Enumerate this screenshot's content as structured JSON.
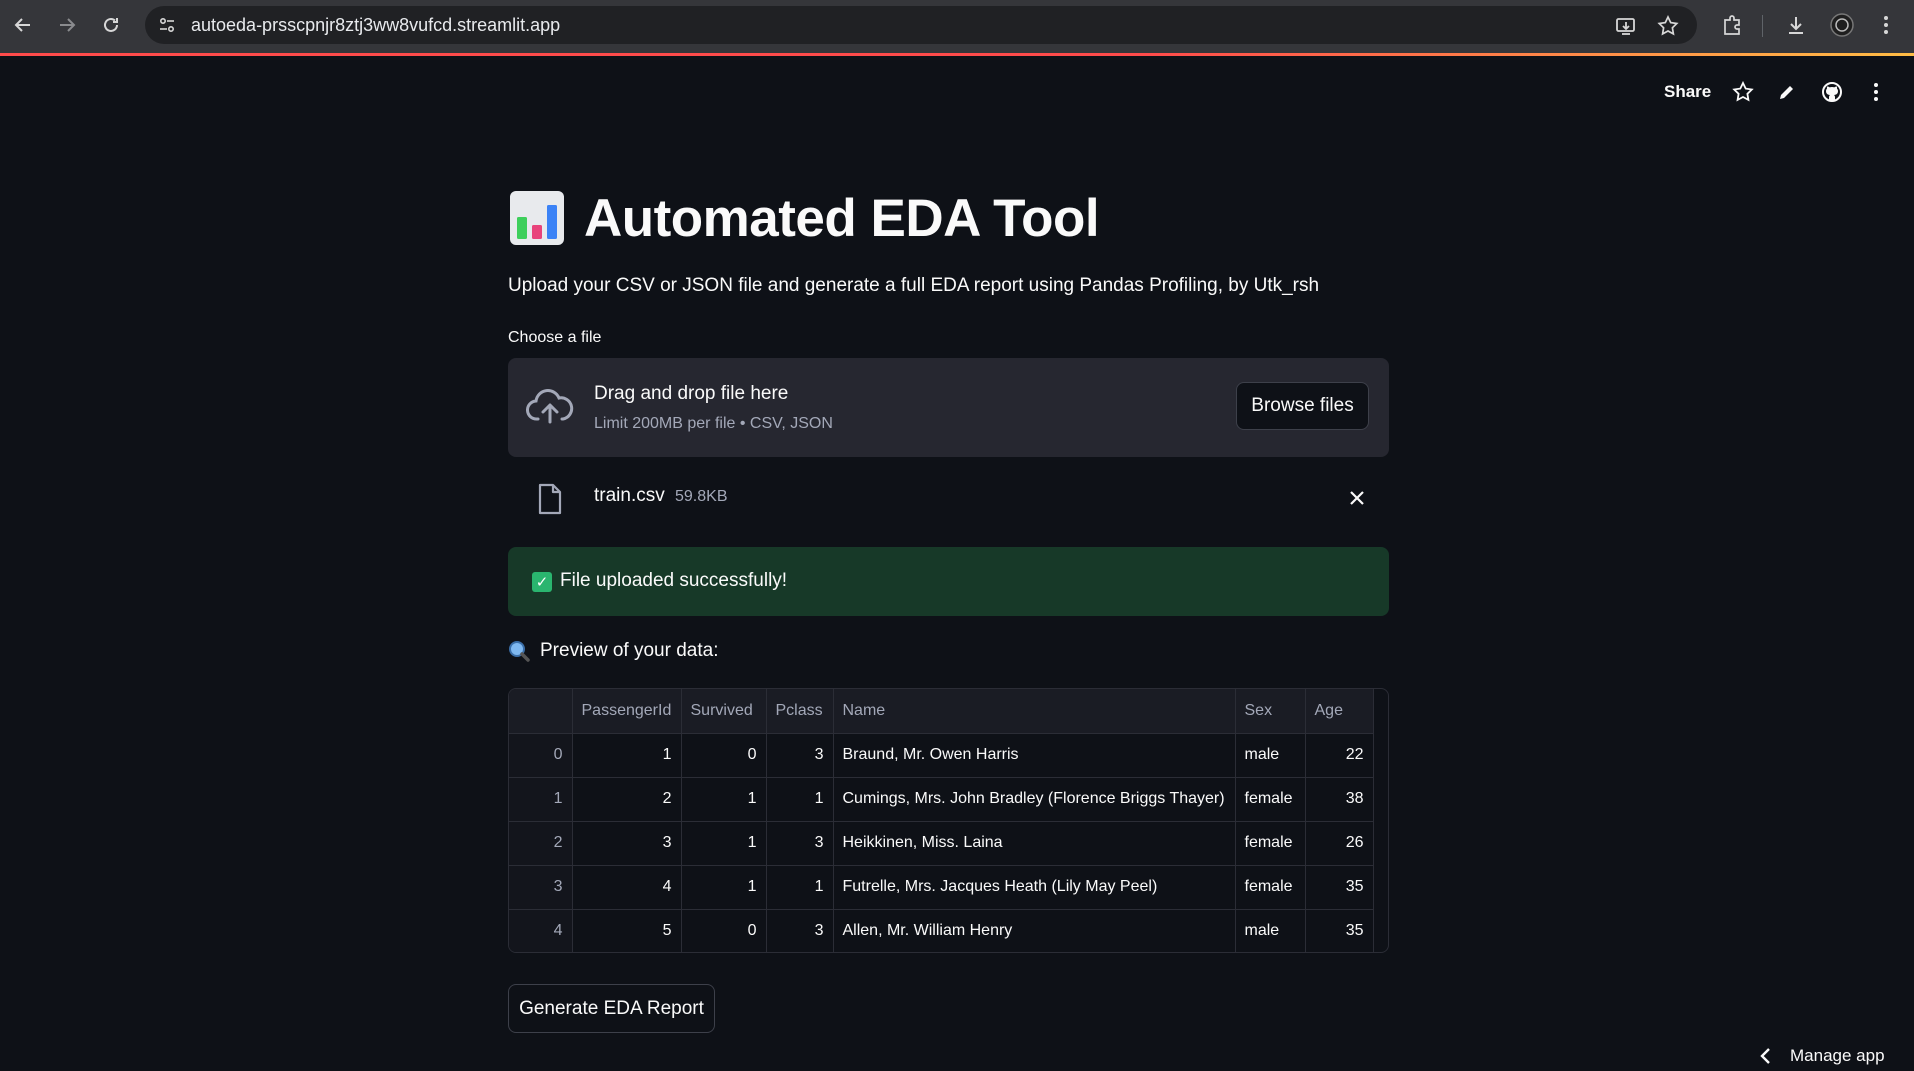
{
  "browser": {
    "url": "autoeda-prsscpnjr8ztj3ww8vufcd.streamlit.app",
    "back_icon": "back-arrow-icon",
    "forward_icon": "forward-arrow-icon",
    "reload_icon": "reload-icon"
  },
  "header": {
    "share_label": "Share"
  },
  "app": {
    "title": "Automated EDA Tool",
    "subtitle": "Upload your CSV or JSON file and generate a full EDA report using Pandas Profiling, by Utk_rsh"
  },
  "uploader": {
    "label": "Choose a file",
    "drop_text": "Drag and drop file here",
    "limit_text": "Limit 200MB per file • CSV, JSON",
    "browse_label": "Browse files",
    "file_name": "train.csv",
    "file_size": "59.8KB"
  },
  "success": {
    "message": "File uploaded successfully!",
    "color": "#173928"
  },
  "preview": {
    "heading": "Preview of your data:",
    "columns": [
      "PassengerId",
      "Survived",
      "Pclass",
      "Name",
      "Sex",
      "Age"
    ],
    "rows": [
      {
        "index": "0",
        "cells": [
          "1",
          "0",
          "3",
          "Braund, Mr. Owen Harris",
          "male",
          "22"
        ]
      },
      {
        "index": "1",
        "cells": [
          "2",
          "1",
          "1",
          "Cumings, Mrs. John Bradley (Florence Briggs Thayer)",
          "female",
          "38"
        ]
      },
      {
        "index": "2",
        "cells": [
          "3",
          "1",
          "3",
          "Heikkinen, Miss. Laina",
          "female",
          "26"
        ]
      },
      {
        "index": "3",
        "cells": [
          "4",
          "1",
          "1",
          "Futrelle, Mrs. Jacques Heath (Lily May Peel)",
          "female",
          "35"
        ]
      },
      {
        "index": "4",
        "cells": [
          "5",
          "0",
          "3",
          "Allen, Mr. William Henry",
          "male",
          "35"
        ]
      }
    ]
  },
  "actions": {
    "generate_label": "Generate EDA Report"
  },
  "footer": {
    "manage_label": "Manage app"
  },
  "colors": {
    "background": "#0e1117",
    "surface": "#262730",
    "accent": "#ff4b4b"
  }
}
